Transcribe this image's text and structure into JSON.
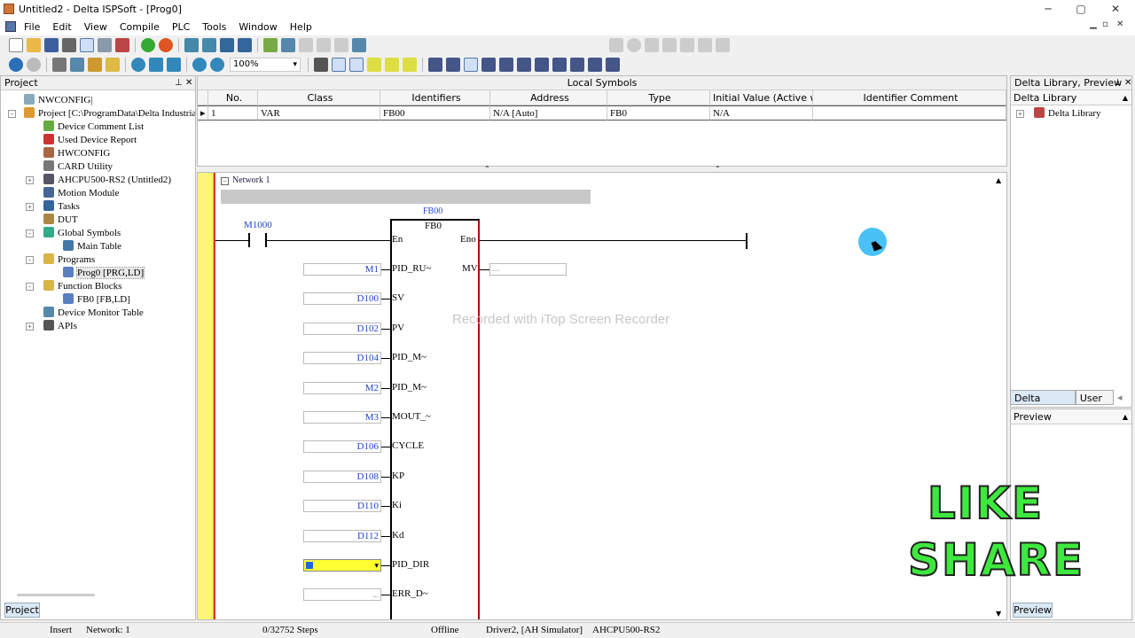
{
  "window": {
    "title": "Untitled2 - Delta ISPSoft - [Prog0]",
    "controls": [
      "─",
      "▢",
      "✕"
    ]
  },
  "menu": [
    "File",
    "Edit",
    "View",
    "Compile",
    "PLC",
    "Tools",
    "Window",
    "Help"
  ],
  "mdi_controls": [
    "▁",
    "▫",
    "✕"
  ],
  "toolbar": {
    "zoom": "100%"
  },
  "project_panel": {
    "title": "Project",
    "tab": "Project",
    "tree": [
      {
        "label": "NWCONFIG|",
        "icon": "network-icon",
        "depth": 0
      },
      {
        "label": "Project [C:\\ProgramData\\Delta Industrial Au",
        "icon": "project-icon",
        "depth": 0,
        "exp": "-"
      },
      {
        "label": "Device Comment List",
        "icon": "comment-list-icon",
        "depth": 1
      },
      {
        "label": "Used Device Report",
        "icon": "report-icon",
        "depth": 1
      },
      {
        "label": "HWCONFIG",
        "icon": "hwconfig-icon",
        "depth": 1
      },
      {
        "label": "CARD Utility",
        "icon": "card-icon",
        "depth": 1
      },
      {
        "label": "AHCPU500-RS2  (Untitled2)",
        "icon": "cpu-icon",
        "depth": 1,
        "exp": "+"
      },
      {
        "label": "Motion Module",
        "icon": "motion-icon",
        "depth": 1
      },
      {
        "label": "Tasks",
        "icon": "tasks-icon",
        "depth": 1,
        "exp": "+"
      },
      {
        "label": "DUT",
        "icon": "dut-icon",
        "depth": 1
      },
      {
        "label": "Global Symbols",
        "icon": "globe-icon",
        "depth": 1,
        "exp": "-"
      },
      {
        "label": "Main Table",
        "icon": "table-icon",
        "depth": 2
      },
      {
        "label": "Programs",
        "icon": "folder-icon",
        "depth": 1,
        "exp": "-"
      },
      {
        "label": "Prog0 [PRG,LD]",
        "icon": "program-icon",
        "depth": 2,
        "selected": true
      },
      {
        "label": "Function Blocks",
        "icon": "folder-icon",
        "depth": 1,
        "exp": "-"
      },
      {
        "label": "FB0 [FB,LD]",
        "icon": "fb-icon",
        "depth": 2
      },
      {
        "label": "Device Monitor Table",
        "icon": "monitor-icon",
        "depth": 1
      },
      {
        "label": "APIs",
        "icon": "api-icon",
        "depth": 1,
        "exp": "+"
      }
    ]
  },
  "local_symbols": {
    "title": "Local Symbols",
    "columns": [
      "",
      "No.",
      "Class",
      "Identifiers",
      "Address",
      "Type",
      "Initial Value (Active wh...",
      "Identifier Comment"
    ],
    "rows": [
      [
        "▸",
        "1",
        "VAR",
        "FB00",
        "N/A [Auto]",
        "FB0",
        "N/A",
        ""
      ]
    ]
  },
  "network": {
    "label": "Network 1",
    "contact": "M1000",
    "fb_instance": "FB00",
    "fb_type": "FB0",
    "en": "En",
    "eno": "Eno",
    "mv_label": "MV",
    "mv_value": "...",
    "inputs": [
      {
        "value": "M1",
        "pin": "PID_RU~"
      },
      {
        "value": "D100",
        "pin": "SV"
      },
      {
        "value": "D102",
        "pin": "PV"
      },
      {
        "value": "D104",
        "pin": "PID_M~"
      },
      {
        "value": "M2",
        "pin": "PID_M~"
      },
      {
        "value": "M3",
        "pin": "MOUT_~"
      },
      {
        "value": "D106",
        "pin": "CYCLE"
      },
      {
        "value": "D108",
        "pin": "KP"
      },
      {
        "value": "D110",
        "pin": "Ki"
      },
      {
        "value": "D112",
        "pin": "Kd"
      },
      {
        "value": "",
        "pin": "PID_DIR"
      },
      {
        "value": "...",
        "pin": "ERR_D~"
      }
    ],
    "watermark": "Recorded with iTop Screen Recorder"
  },
  "library": {
    "title": "Delta Library, Preview",
    "section": "Delta Library",
    "item": "Delta Library",
    "tabs": [
      "Delta Library",
      "User D"
    ]
  },
  "preview": {
    "title": "Preview",
    "tab": "Preview"
  },
  "overlay": {
    "like": "LIKE",
    "share": "SHARE"
  },
  "status": {
    "mode": "Insert",
    "network": "Network: 1",
    "steps": "0/32752 Steps",
    "conn": "Offline",
    "driver": "Driver2, [AH Simulator]",
    "cpu": "AHCPU500-RS2"
  },
  "colors": {
    "ladder_rail": "#fff37a",
    "rail_red": "#dd3333",
    "operand_blue": "#2244cc",
    "overlay_green": "#3ee83e"
  }
}
